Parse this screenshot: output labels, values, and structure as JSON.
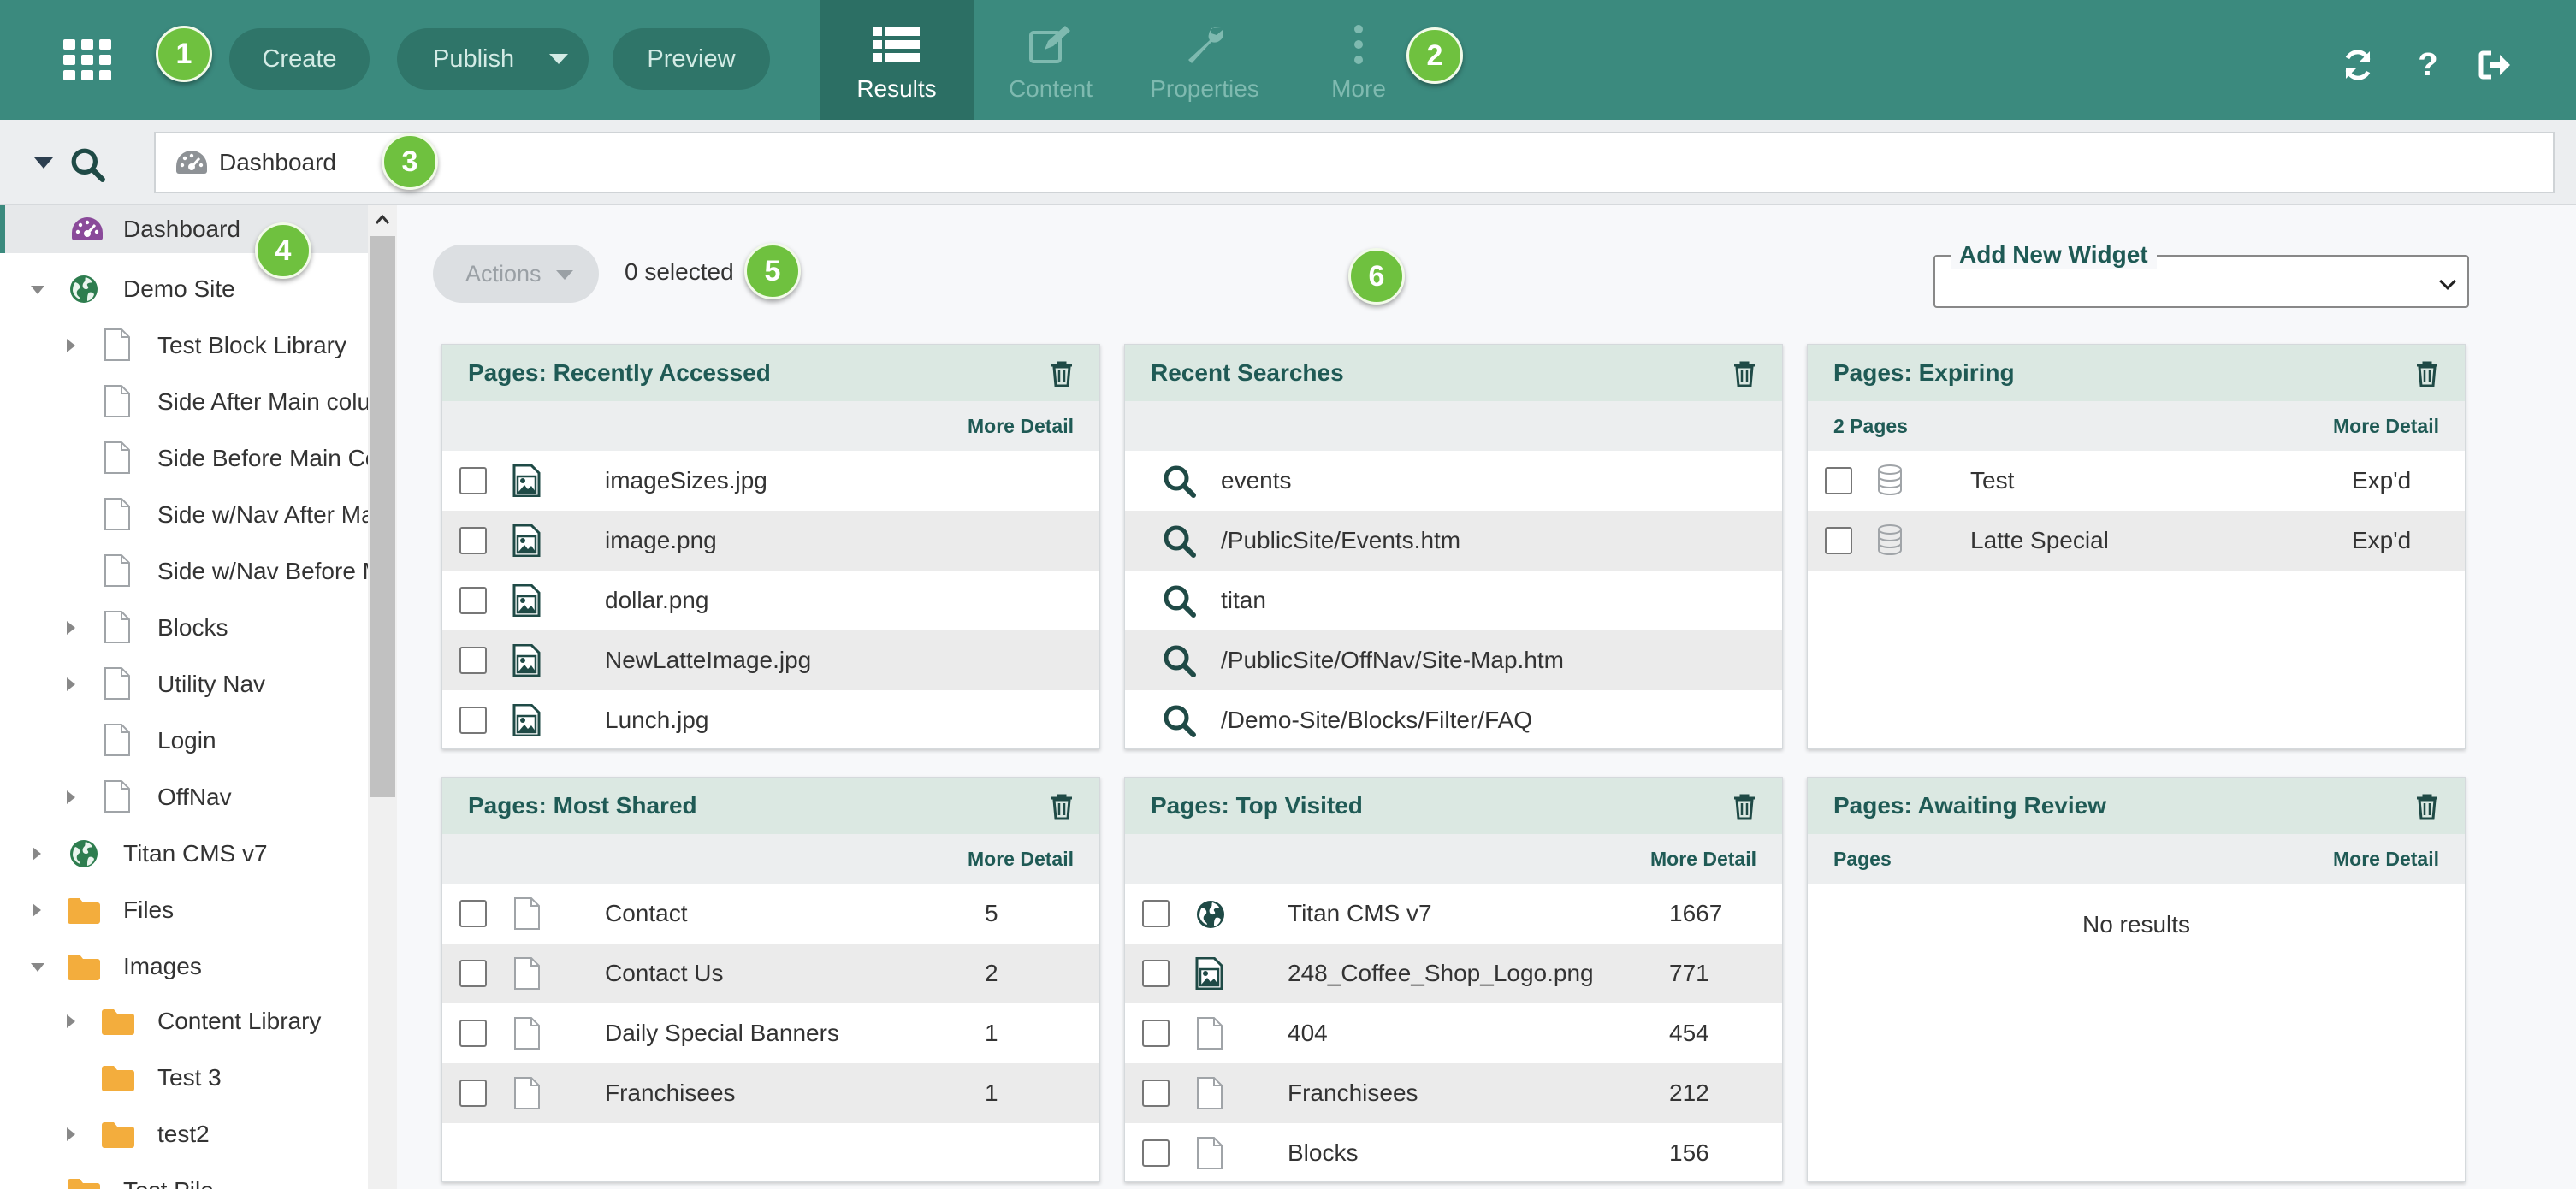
{
  "toolbar": {
    "create_label": "Create",
    "publish_label": "Publish",
    "preview_label": "Preview",
    "tabs": [
      {
        "label": "Results",
        "icon": "list-icon",
        "active": true
      },
      {
        "label": "Content",
        "icon": "edit-icon",
        "active": false
      },
      {
        "label": "Properties",
        "icon": "wrench-icon",
        "active": false
      },
      {
        "label": "More",
        "icon": "more-icon",
        "active": false
      }
    ],
    "right_icons": [
      "refresh-icon",
      "help-icon",
      "logout-icon"
    ],
    "help_glyph": "?"
  },
  "callouts": [
    "1",
    "2",
    "3",
    "4",
    "5",
    "6"
  ],
  "search": {
    "breadcrumb": "Dashboard"
  },
  "sidebar": {
    "items": [
      {
        "label": "Dashboard",
        "icon": "dashboard-icon"
      },
      {
        "label": "Demo Site",
        "icon": "globe-icon"
      },
      {
        "label": "Test Block Library",
        "icon": "page-icon"
      },
      {
        "label": "Side After Main column",
        "icon": "page-icon"
      },
      {
        "label": "Side Before Main Column",
        "icon": "page-icon"
      },
      {
        "label": "Side w/Nav After Main",
        "icon": "page-icon"
      },
      {
        "label": "Side w/Nav Before Main",
        "icon": "page-icon"
      },
      {
        "label": "Blocks",
        "icon": "page-icon"
      },
      {
        "label": "Utility Nav",
        "icon": "page-icon"
      },
      {
        "label": "Login",
        "icon": "page-icon"
      },
      {
        "label": "OffNav",
        "icon": "page-icon"
      },
      {
        "label": "Titan CMS v7",
        "icon": "globe-icon"
      },
      {
        "label": "Files",
        "icon": "folder-icon"
      },
      {
        "label": "Images",
        "icon": "folder-icon"
      },
      {
        "label": "Content Library",
        "icon": "folder-icon"
      },
      {
        "label": "Test 3",
        "icon": "folder-icon"
      },
      {
        "label": "test2",
        "icon": "folder-icon"
      },
      {
        "label": "Test Pile",
        "icon": "folder-icon"
      }
    ]
  },
  "main": {
    "actions_label": "Actions",
    "selected_text": "0 selected",
    "add_widget_label": "Add New Widget"
  },
  "widgets": {
    "recently_accessed": {
      "title": "Pages: Recently Accessed",
      "more": "More Detail",
      "rows": [
        {
          "name": "imageSizes.jpg"
        },
        {
          "name": "image.png"
        },
        {
          "name": "dollar.png"
        },
        {
          "name": "NewLatteImage.jpg"
        },
        {
          "name": "Lunch.jpg"
        }
      ]
    },
    "recent_searches": {
      "title": "Recent Searches",
      "rows": [
        {
          "name": "events"
        },
        {
          "name": "/PublicSite/Events.htm"
        },
        {
          "name": "titan"
        },
        {
          "name": "/PublicSite/OffNav/Site-Map.htm"
        },
        {
          "name": "/Demo-Site/Blocks/Filter/FAQ"
        }
      ]
    },
    "expiring": {
      "title": "Pages: Expiring",
      "count": "2 Pages",
      "more": "More Detail",
      "rows": [
        {
          "name": "Test",
          "status": "Exp'd"
        },
        {
          "name": "Latte Special",
          "status": "Exp'd"
        }
      ]
    },
    "most_shared": {
      "title": "Pages: Most Shared",
      "more": "More Detail",
      "rows": [
        {
          "name": "Contact",
          "value": "5"
        },
        {
          "name": "Contact Us",
          "value": "2"
        },
        {
          "name": "Daily Special Banners",
          "value": "1"
        },
        {
          "name": "Franchisees",
          "value": "1"
        }
      ]
    },
    "top_visited": {
      "title": "Pages: Top Visited",
      "more": "More Detail",
      "rows": [
        {
          "name": "Titan CMS v7",
          "value": "1667",
          "icon": "globe-icon"
        },
        {
          "name": "248_Coffee_Shop_Logo.png",
          "value": "771",
          "icon": "image-icon"
        },
        {
          "name": "404",
          "value": "454",
          "icon": "page-icon"
        },
        {
          "name": "Franchisees",
          "value": "212",
          "icon": "page-icon"
        },
        {
          "name": "Blocks",
          "value": "156",
          "icon": "page-icon"
        }
      ]
    },
    "awaiting_review": {
      "title": "Pages: Awaiting Review",
      "column": "Pages",
      "more": "More Detail",
      "empty": "No results"
    }
  },
  "colors": {
    "topbar": "#3b8a7e",
    "accent": "#1f5a55",
    "callout": "#6fc13f"
  }
}
